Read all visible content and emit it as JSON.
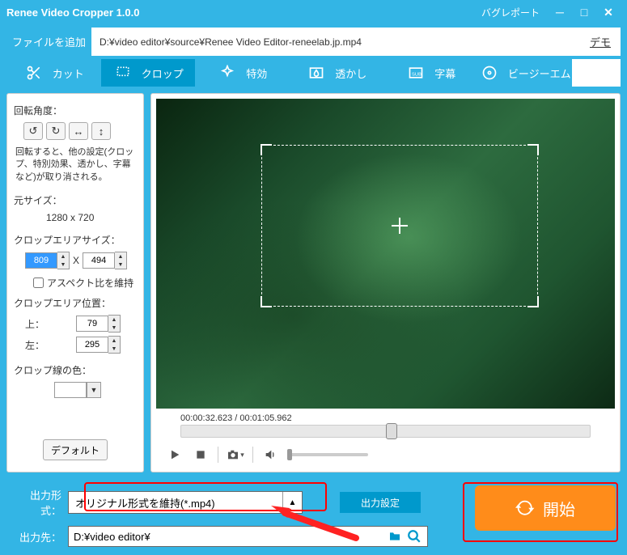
{
  "title": "Renee Video Cropper 1.0.0",
  "bug_report": "バグレポート",
  "add_file": "ファイルを追加",
  "filepath": "D:¥video editor¥source¥Renee Video Editor-reneelab.jp.mp4",
  "demo": "デモ",
  "tabs": {
    "cut": "カット",
    "crop": "クロップ",
    "effect": "特効",
    "watermark": "透かし",
    "subtitle": "字幕",
    "bgm": "ビージーエム"
  },
  "left": {
    "rot_angle": "回転角度：",
    "rot_note": "回転すると、他の設定(クロップ、特別効果、透かし、字幕など)が取り消される。",
    "orig_size_lbl": "元サイズ：",
    "orig_size_val": "1280 x 720",
    "crop_size_lbl": "クロップエリアサイズ：",
    "crop_w": "809",
    "crop_h": "494",
    "x": "X",
    "keep_aspect": "アスペクト比を維持",
    "crop_pos_lbl": "クロップエリア位置：",
    "top_lbl": "上：",
    "top_val": "79",
    "left_lbl": "左：",
    "left_val": "295",
    "line_color_lbl": "クロップ線の色：",
    "default_btn": "デフォルト"
  },
  "timecode": "00:00:32.623 / 00:01:05.962",
  "bottom": {
    "fmt_lbl": "出力形式：",
    "fmt_val": "オリジナル形式を維持(*.mp4)",
    "out_settings": "出力設定",
    "start": "開始",
    "out_lbl": "出力先：",
    "out_path": "D:¥video editor¥"
  }
}
